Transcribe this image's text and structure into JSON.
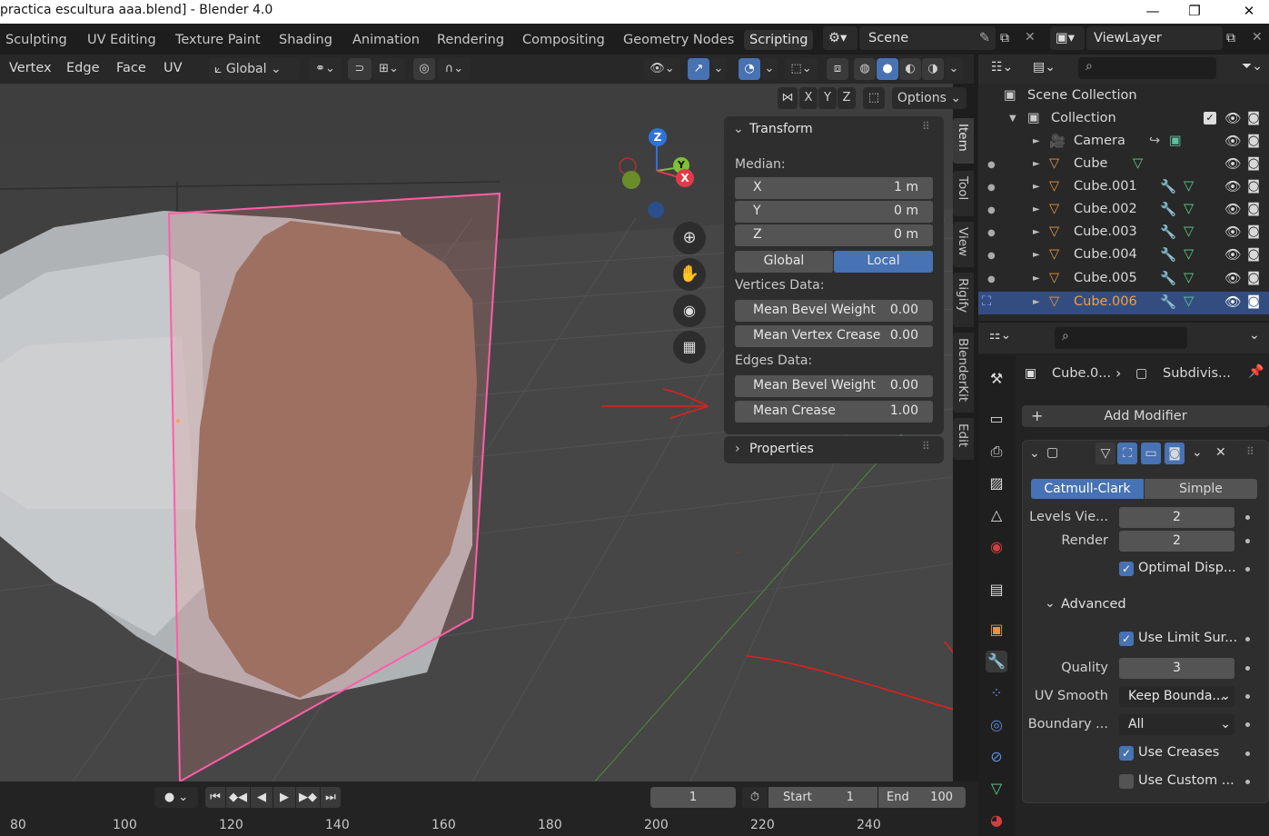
{
  "window": {
    "title": "practica escultura aaa.blend] - Blender 4.0"
  },
  "workspace_tabs": [
    "Sculpting",
    "UV Editing",
    "Texture Paint",
    "Shading",
    "Animation",
    "Rendering",
    "Compositing",
    "Geometry Nodes",
    "Scripting"
  ],
  "top_right": {
    "scene": "Scene",
    "view_layer": "ViewLayer"
  },
  "viewport_header": {
    "menus": [
      "Vertex",
      "Edge",
      "Face",
      "UV"
    ],
    "orientation": "Global",
    "options_label": "Options",
    "axis_buttons": [
      "X",
      "Y",
      "Z"
    ]
  },
  "gizmo": {
    "z": "Z",
    "y": "Y",
    "x": "X"
  },
  "sidebar_tabs": [
    "Item",
    "Tool",
    "View",
    "Rigify",
    "BlenderKit",
    "Edit"
  ],
  "transform_panel": {
    "title": "Transform",
    "median_label": "Median:",
    "median": [
      {
        "axis": "X",
        "value": "1 m"
      },
      {
        "axis": "Y",
        "value": "0 m"
      },
      {
        "axis": "Z",
        "value": "0 m"
      }
    ],
    "space_options": [
      "Global",
      "Local"
    ],
    "space_selected": "Local",
    "vertices_label": "Vertices Data:",
    "vertices": [
      {
        "label": "Mean Bevel Weight",
        "value": "0.00"
      },
      {
        "label": "Mean Vertex Crease",
        "value": "0.00"
      }
    ],
    "edges_label": "Edges Data:",
    "edges": [
      {
        "label": "Mean Bevel Weight",
        "value": "0.00"
      },
      {
        "label": "Mean Crease",
        "value": "1.00"
      }
    ],
    "properties_title": "Properties"
  },
  "outliner": {
    "scene_collection": "Scene Collection",
    "collection": "Collection",
    "items": [
      "Camera",
      "Cube",
      "Cube.001",
      "Cube.002",
      "Cube.003",
      "Cube.004",
      "Cube.005",
      "Cube.006"
    ],
    "selected": "Cube.006"
  },
  "properties": {
    "breadcrumb_object": "Cube.0...",
    "breadcrumb_modifier": "Subdivis...",
    "add_modifier": "Add Modifier",
    "subdiv_types": [
      "Catmull-Clark",
      "Simple"
    ],
    "levels_viewport_label": "Levels Vie...",
    "levels_viewport": "2",
    "render_label": "Render",
    "render": "2",
    "optimal_display": "Optimal Disp...",
    "advanced": "Advanced",
    "use_limit_surface": "Use Limit Sur...",
    "quality_label": "Quality",
    "quality": "3",
    "uv_smooth_label": "UV Smooth",
    "uv_smooth": "Keep Bounda...",
    "boundary_label": "Boundary ...",
    "boundary": "All",
    "use_creases": "Use Creases",
    "use_custom": "Use Custom ..."
  },
  "timeline": {
    "current_frame": "1",
    "start_label": "Start",
    "start": "1",
    "end_label": "End",
    "end": "100",
    "ruler": [
      "80",
      "100",
      "120",
      "140",
      "160",
      "180",
      "200",
      "220",
      "240"
    ]
  },
  "colors": {
    "accent_blue": "#4772b3",
    "selection_outline": "#ff5ea8",
    "annotation_red": "#e0201c",
    "face_fill": "#8a6a58"
  }
}
